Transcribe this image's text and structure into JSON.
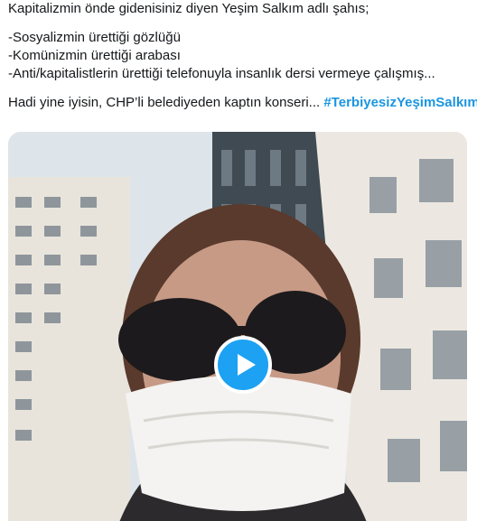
{
  "tweet": {
    "lines": [
      "Kapitalizmin önde gidenisiniz diyen Yeşim Salkım adlı şahıs;",
      "",
      "-Sosyalizmin ürettiği gözlüğü",
      "-Komünizmin ürettiği arabası",
      "-Anti/kapitalistlerin ürettiği telefonuyla insanlık dersi vermeye çalışmış...",
      "",
      "Hadi yine iyisin, CHP’li belediyeden kaptın konseri... "
    ],
    "hashtag": "#TerbiyesizYeşimSalkım"
  },
  "media": {
    "type": "video",
    "play_icon": "play-icon",
    "accent_color": "#1da1f2"
  }
}
